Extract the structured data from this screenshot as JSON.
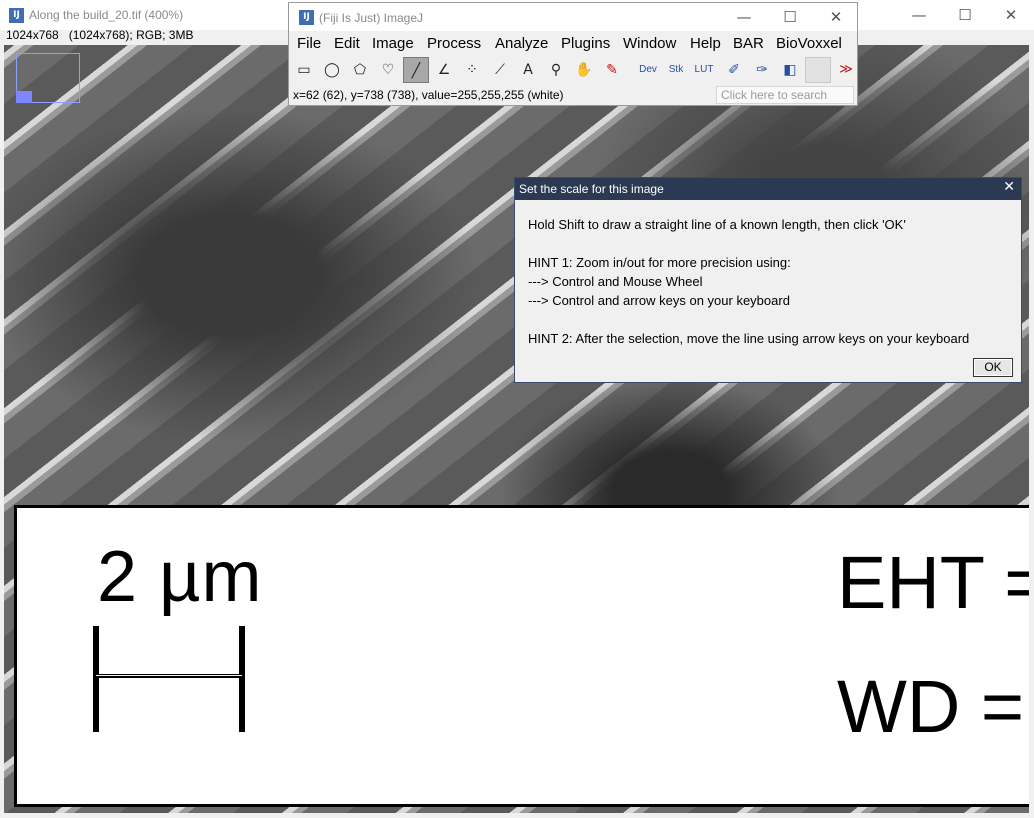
{
  "image_window": {
    "title": "Along the build_20.tif (400%)",
    "info": "1024x768   (1024x768); RGB; 3MB",
    "controls": {
      "minimize": "—",
      "maximize": "☐",
      "close": "✕"
    }
  },
  "image_content": {
    "scale_label": "2 µm",
    "eht_label": "EHT =",
    "wd_label": "WD ="
  },
  "fiji_window": {
    "title": "(Fiji Is Just) ImageJ",
    "controls": {
      "minimize": "—",
      "maximize": "☐",
      "close": "✕"
    },
    "menu": [
      "File",
      "Edit",
      "Image",
      "Process",
      "Analyze",
      "Plugins",
      "Window",
      "Help",
      "BAR",
      "BioVoxxel"
    ],
    "tools": [
      {
        "name": "rectangle-tool-icon",
        "glyph": "▭"
      },
      {
        "name": "oval-tool-icon",
        "glyph": "◯"
      },
      {
        "name": "polygon-tool-icon",
        "glyph": "⬠"
      },
      {
        "name": "freehand-tool-icon",
        "glyph": "♡"
      },
      {
        "name": "line-tool-icon",
        "glyph": "╱"
      },
      {
        "name": "angle-tool-icon",
        "glyph": "∠"
      },
      {
        "name": "multipoint-tool-icon",
        "glyph": "⁘"
      },
      {
        "name": "wand-tool-icon",
        "glyph": "⟋"
      },
      {
        "name": "text-tool-icon",
        "glyph": "A"
      },
      {
        "name": "magnifier-tool-icon",
        "glyph": "⚲"
      },
      {
        "name": "hand-tool-icon",
        "glyph": "✋"
      },
      {
        "name": "color-picker-tool-icon",
        "glyph": "✎"
      },
      {
        "name": "dev-menu-icon",
        "glyph": "Dev"
      },
      {
        "name": "stk-menu-icon",
        "glyph": "Stk"
      },
      {
        "name": "lut-menu-icon",
        "glyph": "LUT"
      },
      {
        "name": "pencil-tool-icon",
        "glyph": "✐"
      },
      {
        "name": "brush-tool-icon",
        "glyph": "✑"
      },
      {
        "name": "flood-fill-tool-icon",
        "glyph": "◧"
      },
      {
        "name": "empty-tool-slot-icon",
        "glyph": ""
      },
      {
        "name": "more-tools-icon",
        "glyph": "≫"
      }
    ],
    "status": "x=62 (62), y=738 (738), value=255,255,255 (white)",
    "search_placeholder": "Click here to search"
  },
  "dialog": {
    "title": "Set the scale for this image",
    "close": "✕",
    "lines": [
      "Hold Shift to draw a straight line of a known length, then click 'OK'",
      "HINT 1: Zoom in/out for more precision using:",
      "---> Control and Mouse Wheel",
      "---> Control and arrow keys on your keyboard",
      "HINT 2: After the selection, move the line using arrow keys on your keyboard"
    ],
    "ok_label": "OK"
  }
}
